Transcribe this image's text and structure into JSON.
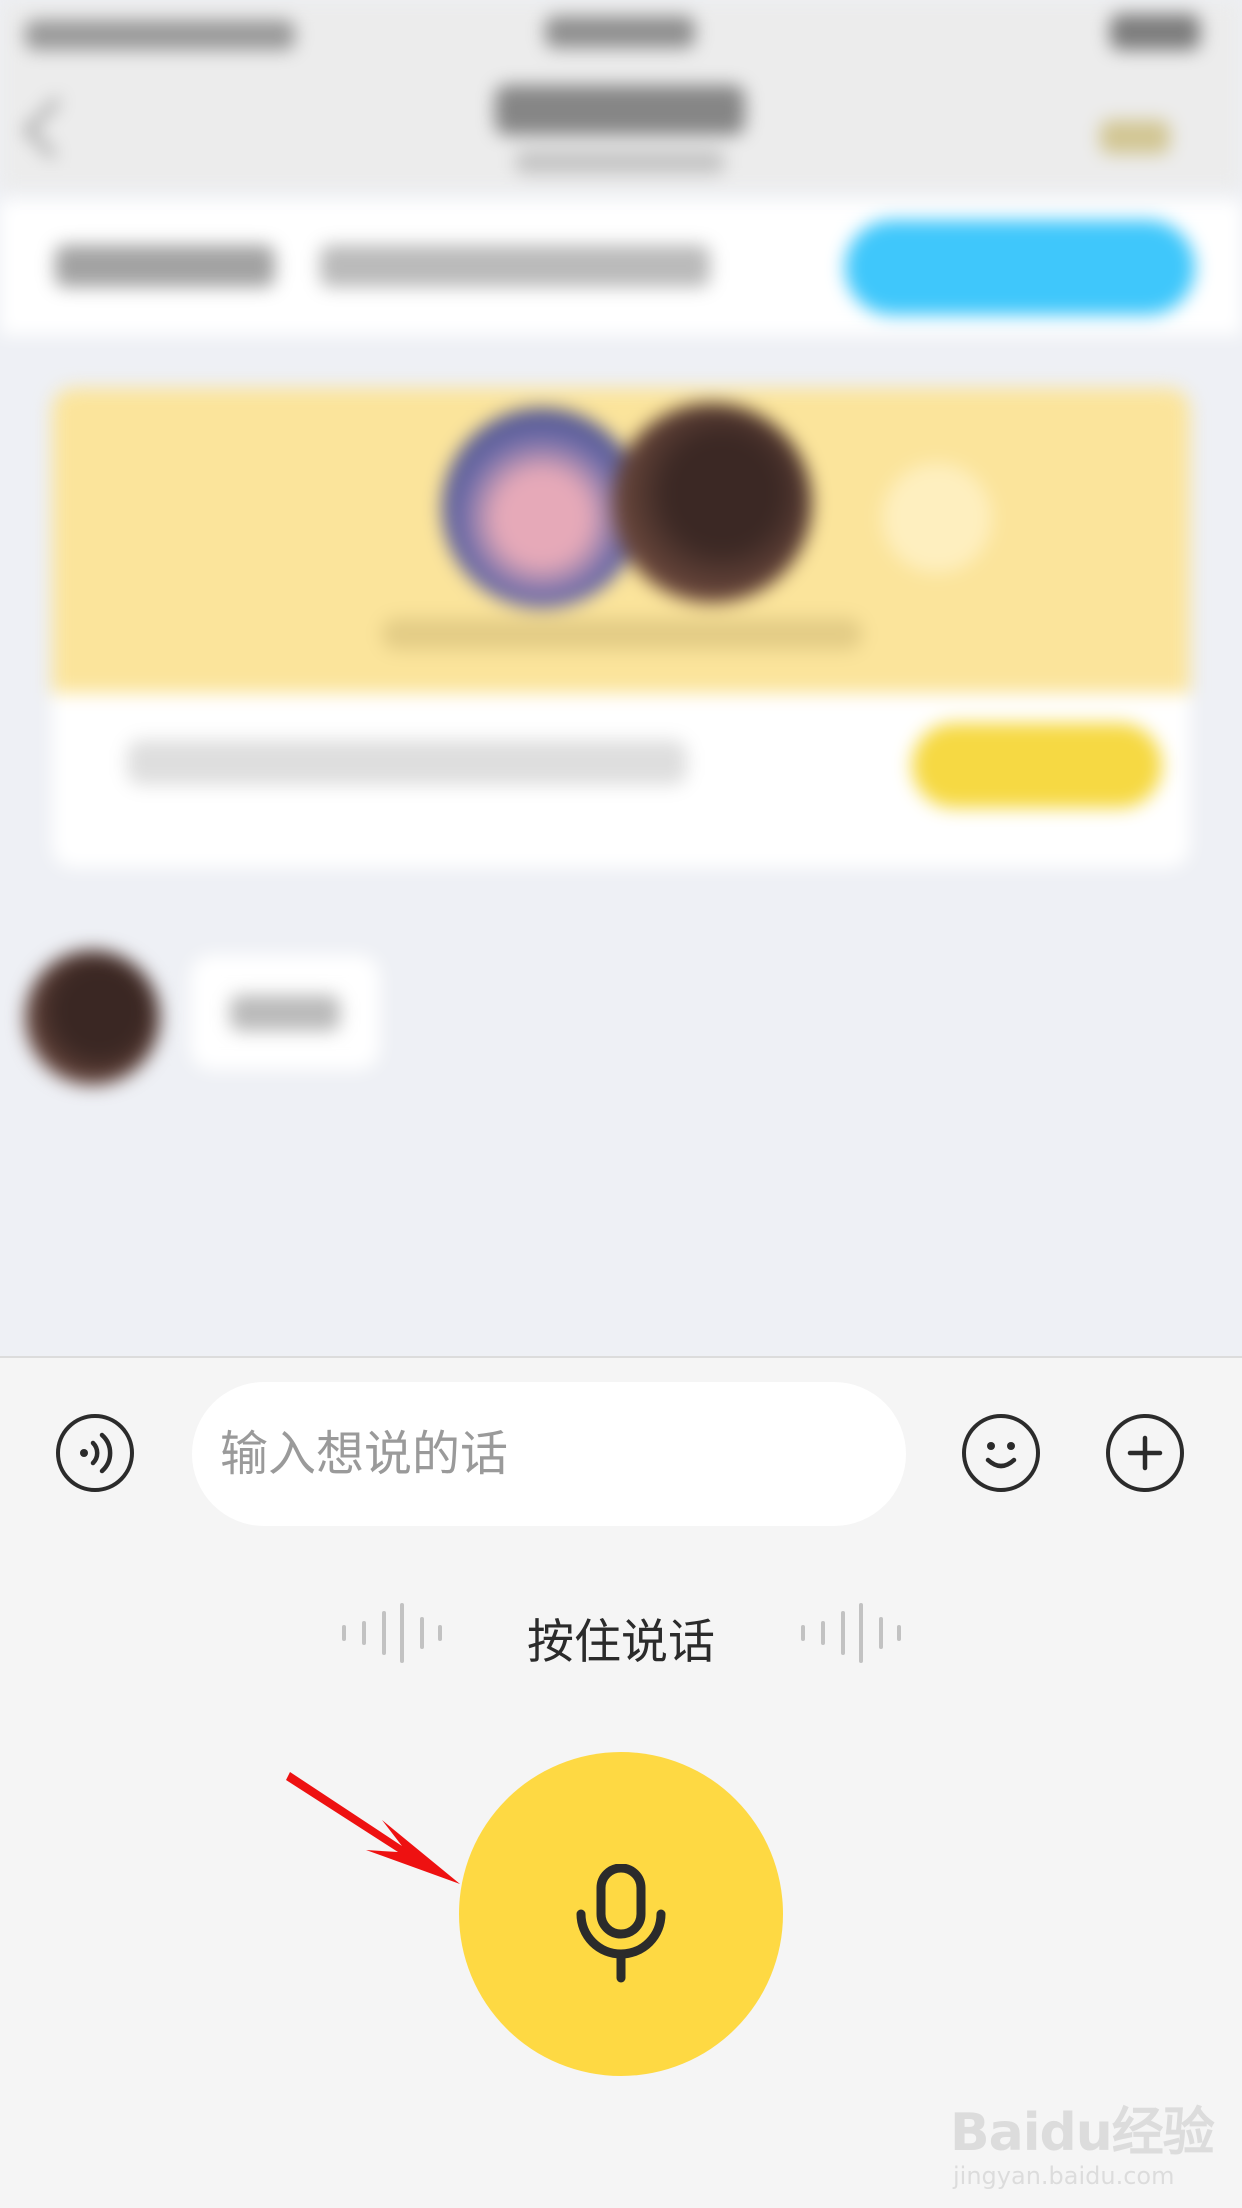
{
  "composer": {
    "input_placeholder": "输入想说的话",
    "input_value": "",
    "hold_to_talk_label": "按住说话"
  },
  "icons": {
    "voice_toggle": "voice-wave-icon",
    "emoji": "smiley-icon",
    "plus": "plus-icon",
    "mic": "microphone-icon"
  },
  "colors": {
    "mic_button": "#fed943",
    "annotation_arrow": "#ee1111",
    "info_bar_button": "#3fc7fb",
    "card_button": "#f6d943"
  },
  "watermark": {
    "logo": "Baidu经验",
    "url": "jingyan.baidu.com"
  }
}
